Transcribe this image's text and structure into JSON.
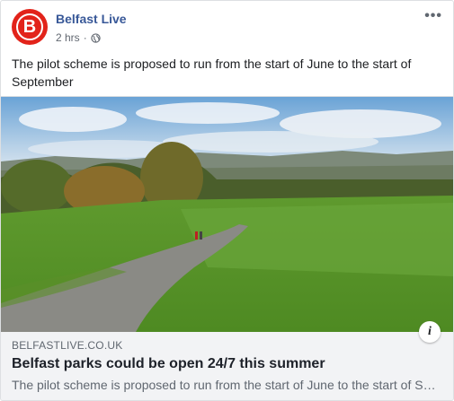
{
  "post": {
    "page_name": "Belfast Live",
    "avatar_letter": "B",
    "timestamp": "2 hrs",
    "separator": "·",
    "privacy_icon": "globe-icon",
    "more_icon": "more-options-icon",
    "more_label": "•••",
    "text": "The pilot scheme is proposed to run from the start of June to the start of September"
  },
  "link": {
    "image_description_icon": "park-photo",
    "info_label": "i",
    "domain": "BELFASTLIVE.CO.UK",
    "headline": "Belfast parks could be open 24/7 this summer",
    "description": "The pilot scheme is proposed to run from the start of June to the start of September"
  },
  "colors": {
    "brand_red": "#e2231a",
    "link_blue": "#385898",
    "muted": "#606770"
  }
}
